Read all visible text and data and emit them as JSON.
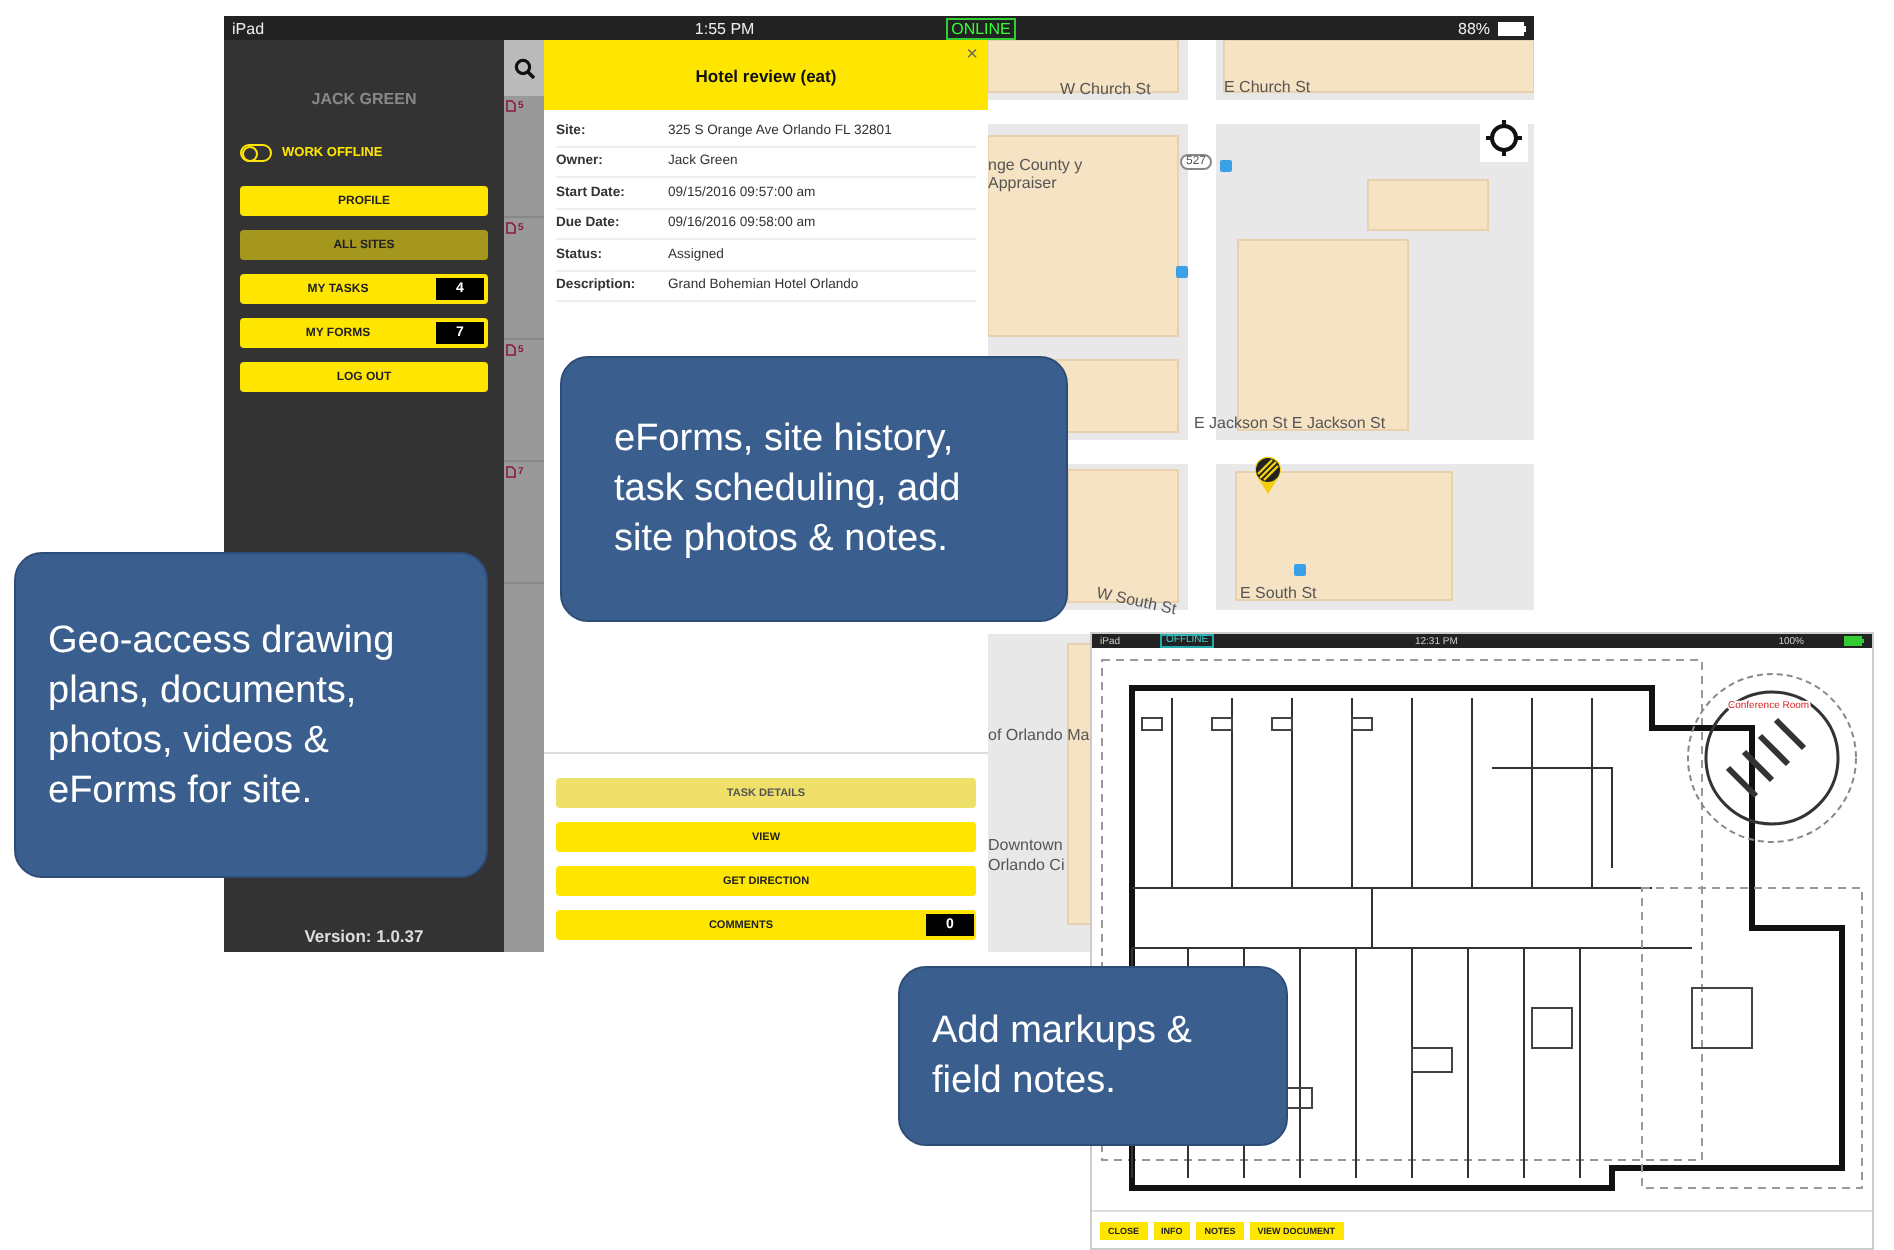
{
  "tablet_app": {
    "status_bar": {
      "device": "iPad",
      "time": "1:55 PM",
      "connection": "ONLINE",
      "battery": "88%"
    },
    "sidebar": {
      "user": "JACK GREEN",
      "work_offline": {
        "label": "WORK OFFLINE",
        "on": false
      },
      "menu": [
        {
          "label": "PROFILE",
          "selected": false
        },
        {
          "label": "ALL SITES",
          "selected": true
        },
        {
          "label": "MY TASKS",
          "selected": false,
          "count": "4"
        },
        {
          "label": "MY FORMS",
          "selected": false,
          "count": "7"
        },
        {
          "label": "LOG OUT",
          "selected": false
        }
      ],
      "version": "Version: 1.0.37"
    },
    "site_list": {
      "counts": [
        "5",
        "5",
        "5",
        "7"
      ]
    },
    "task_panel": {
      "title": "Hotel review (eat)",
      "close": "×",
      "fields": [
        {
          "label": "Site:",
          "value": "325 S Orange Ave Orlando FL 32801"
        },
        {
          "label": "Owner:",
          "value": "Jack Green"
        },
        {
          "label": "Start Date:",
          "value": "09/15/2016 09:57:00 am"
        },
        {
          "label": "Due Date:",
          "value": "09/16/2016 09:58:00 am"
        },
        {
          "label": "Status:",
          "value": "Assigned"
        },
        {
          "label": "Description:",
          "value": "Grand Bohemian Hotel Orlando"
        }
      ],
      "buttons": [
        {
          "label": "TASK DETAILS",
          "selected": true
        },
        {
          "label": "VIEW",
          "selected": false
        },
        {
          "label": "GET DIRECTION",
          "selected": false
        },
        {
          "label": "COMMENTS",
          "selected": false,
          "count": "0"
        }
      ]
    },
    "map": {
      "labels": [
        "W Church St",
        "E Church St",
        "nge County y Appraiser",
        "527",
        "E Jackson St E Jackson St",
        "W South St",
        "E South St",
        "of Orlando Ma",
        "Downtown",
        "Orlando Ci"
      ]
    }
  },
  "document_viewer": {
    "status_bar": {
      "device": "iPad",
      "connection": "OFFLINE",
      "time": "12:31 PM",
      "battery": "100%"
    },
    "plan_label": "Conference Room",
    "toolbar": [
      "CLOSE",
      "INFO",
      "NOTES",
      "VIEW DOCUMENT"
    ]
  },
  "callouts": [
    "eForms, site history, task scheduling, add site photos & notes.",
    "Geo-access drawing plans, documents, photos, videos & eForms for site.",
    "Add markups & field notes."
  ]
}
